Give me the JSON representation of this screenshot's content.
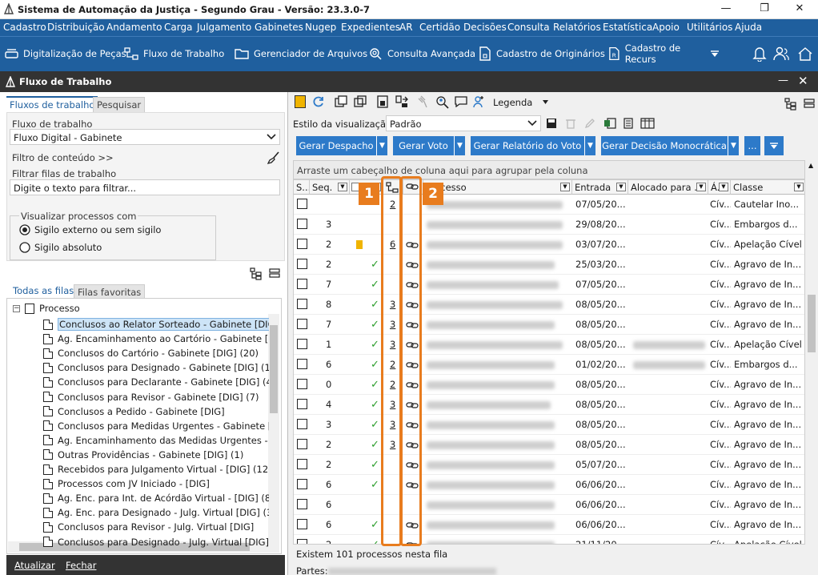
{
  "app": {
    "title": "Sistema de Automação da Justiça - Segundo Grau - Versão: 23.3.0-7"
  },
  "menu": [
    "Cadastro",
    "Distribuição",
    "Andamento",
    "Carga",
    "Julgamento",
    "Gabinetes",
    "Nugep",
    "Expedientes",
    "AR",
    "Certidão",
    "Decisões",
    "Consulta",
    "Relatórios",
    "Estatística",
    "Apoio",
    "Utilitários",
    "Ajuda"
  ],
  "toolbar": {
    "items": [
      "Digitalização de Peças",
      "Fluxo de Trabalho",
      "Gerenciador de Arquivos",
      "Consulta Avançada",
      "Cadastro de Originários",
      "Cadastro de Recurs"
    ]
  },
  "panel": {
    "title": "Fluxo de Trabalho"
  },
  "left": {
    "tabs": [
      "Fluxos de trabalho",
      "Pesquisar"
    ],
    "fluxo_label": "Fluxo de trabalho",
    "fluxo_value": "Fluxo Digital - Gabinete",
    "filtro_conteudo": "Filtro de conteúdo >>",
    "filtrar_label": "Filtrar filas de trabalho",
    "filtrar_placeholder": "Digite o texto para filtrar...",
    "visualizar_label": "Visualizar processos com",
    "radio1": "Sigilo externo ou sem sigilo",
    "radio2": "Sigilo absoluto",
    "queue_tabs": [
      "Todas as filas",
      "Filas favoritas"
    ],
    "tree_root": "Processo",
    "tree": [
      "Conclusos ao Relator Sorteado - Gabinete [DIG] (101)",
      "Ag. Encaminhamento ao Cartório - Gabinete [DIG] (9)",
      "Conclusos do Cartório - Gabinete [DIG] (20)",
      "Conclusos para Designado - Gabinete [DIG] (1)",
      "Conclusos para Declarante - Gabinete [DIG] (4)",
      "Conclusos para Revisor - Gabinete [DIG] (7)",
      "Conclusos a Pedido - Gabinete [DIG]",
      "Conclusos para Medidas Urgentes - Gabinete [DIG] (",
      "Ag. Encaminhamento das Medidas Urgentes - Gab[D",
      "Outras Providências - Gabinete [DIG] (1)",
      "Recebidos para Julgamento Virtual - [DIG] (126)",
      "Processos com JV Iniciado - [DIG]",
      "Ag. Enc. para Int. de Acórdão Virtual - [DIG] (8)",
      "Ag. Enc. para Designado - Julg. Virtual [DIG] (3)",
      "Conclusos para Revisor - Julg. Virtual [DIG]",
      "Conclusos para Designado - Julg. Virtual [DIG] (5)"
    ],
    "btn_atualizar": "Atualizar",
    "btn_fechar": "Fechar"
  },
  "right": {
    "legenda": "Legenda",
    "estilo_label": "Estilo da visualização",
    "estilo_value": "Padrão",
    "buttons": [
      "Gerar Despacho",
      "Gerar Voto",
      "Gerar Relatório do Voto",
      "Gerar Decisão Monocrática",
      "..."
    ],
    "group_hint": "Arraste um cabeçalho de coluna aqui para agrupar pela coluna",
    "columns": [
      "S...",
      "Seq.",
      "",
      "",
      "",
      "Processo",
      "Entrada",
      "Alocado para ...",
      "Á...",
      "Classe"
    ],
    "rows": [
      {
        "seq": "",
        "flag": false,
        "check": false,
        "count": "2",
        "link": false,
        "entrada": "07/05/20...",
        "area": "Cív...",
        "classe": "Cautelar Ino..."
      },
      {
        "seq": "3",
        "flag": false,
        "check": false,
        "count": "",
        "link": false,
        "entrada": "29/08/20...",
        "area": "Cív...",
        "classe": "Embargos d..."
      },
      {
        "seq": "2",
        "flag": true,
        "check": false,
        "count": "6",
        "link": true,
        "entrada": "03/07/20...",
        "area": "Cív...",
        "classe": "Apelação Cível"
      },
      {
        "seq": "2",
        "flag": false,
        "check": true,
        "count": "",
        "link": true,
        "entrada": "25/03/20...",
        "area": "Cív...",
        "classe": "Agravo de In..."
      },
      {
        "seq": "7",
        "flag": false,
        "check": true,
        "count": "",
        "link": true,
        "entrada": "07/05/20...",
        "area": "Cív...",
        "classe": "Agravo de In..."
      },
      {
        "seq": "8",
        "flag": false,
        "check": true,
        "count": "3",
        "link": true,
        "entrada": "08/05/20...",
        "area": "Cív...",
        "classe": "Agravo de In..."
      },
      {
        "seq": "7",
        "flag": false,
        "check": true,
        "count": "3",
        "link": true,
        "entrada": "08/05/20...",
        "area": "Cív...",
        "classe": "Agravo de In..."
      },
      {
        "seq": "1",
        "flag": false,
        "check": true,
        "count": "3",
        "link": true,
        "entrada": "08/05/20...",
        "area": "Cív...",
        "classe": "Apelação Cível"
      },
      {
        "seq": "6",
        "flag": false,
        "check": true,
        "count": "2",
        "link": true,
        "entrada": "01/02/20...",
        "area": "Cív...",
        "classe": "Embargos d..."
      },
      {
        "seq": "0",
        "flag": false,
        "check": true,
        "count": "2",
        "link": true,
        "entrada": "08/05/20...",
        "area": "Cív...",
        "classe": "Agravo de In..."
      },
      {
        "seq": "4",
        "flag": false,
        "check": true,
        "count": "3",
        "link": true,
        "entrada": "08/05/20...",
        "area": "Cív...",
        "classe": "Agravo de In..."
      },
      {
        "seq": "3",
        "flag": false,
        "check": true,
        "count": "3",
        "link": true,
        "entrada": "08/05/20...",
        "area": "Cív...",
        "classe": "Agravo de In..."
      },
      {
        "seq": "2",
        "flag": false,
        "check": true,
        "count": "3",
        "link": true,
        "entrada": "08/05/20...",
        "area": "Cív...",
        "classe": "Agravo de In..."
      },
      {
        "seq": "2",
        "flag": false,
        "check": true,
        "count": "",
        "link": true,
        "entrada": "05/07/20...",
        "area": "Cív...",
        "classe": "Agravo de In..."
      },
      {
        "seq": "6",
        "flag": false,
        "check": true,
        "count": "",
        "link": true,
        "entrada": "06/06/20...",
        "area": "Cív...",
        "classe": "Agravo de In..."
      },
      {
        "seq": "6",
        "flag": false,
        "check": false,
        "count": "",
        "link": false,
        "entrada": "06/06/20...",
        "area": "Cív...",
        "classe": "Agravo de In..."
      },
      {
        "seq": "6",
        "flag": false,
        "check": true,
        "count": "",
        "link": true,
        "entrada": "06/06/20...",
        "area": "Cív...",
        "classe": "Agravo de In..."
      },
      {
        "seq": "2",
        "flag": false,
        "check": true,
        "count": "",
        "link": true,
        "entrada": "21/11/20...",
        "area": "Cív...",
        "classe": "Apelação Cível"
      }
    ],
    "status": "Existem 101 processos nesta fila",
    "partes": "Partes:",
    "callouts": [
      "1",
      "2"
    ]
  },
  "colors": {
    "accent": "#1f5f9e",
    "button": "#2d7ac9",
    "callout": "#e87c1e",
    "check": "#2a9d2a",
    "flag": "#f0b400"
  }
}
